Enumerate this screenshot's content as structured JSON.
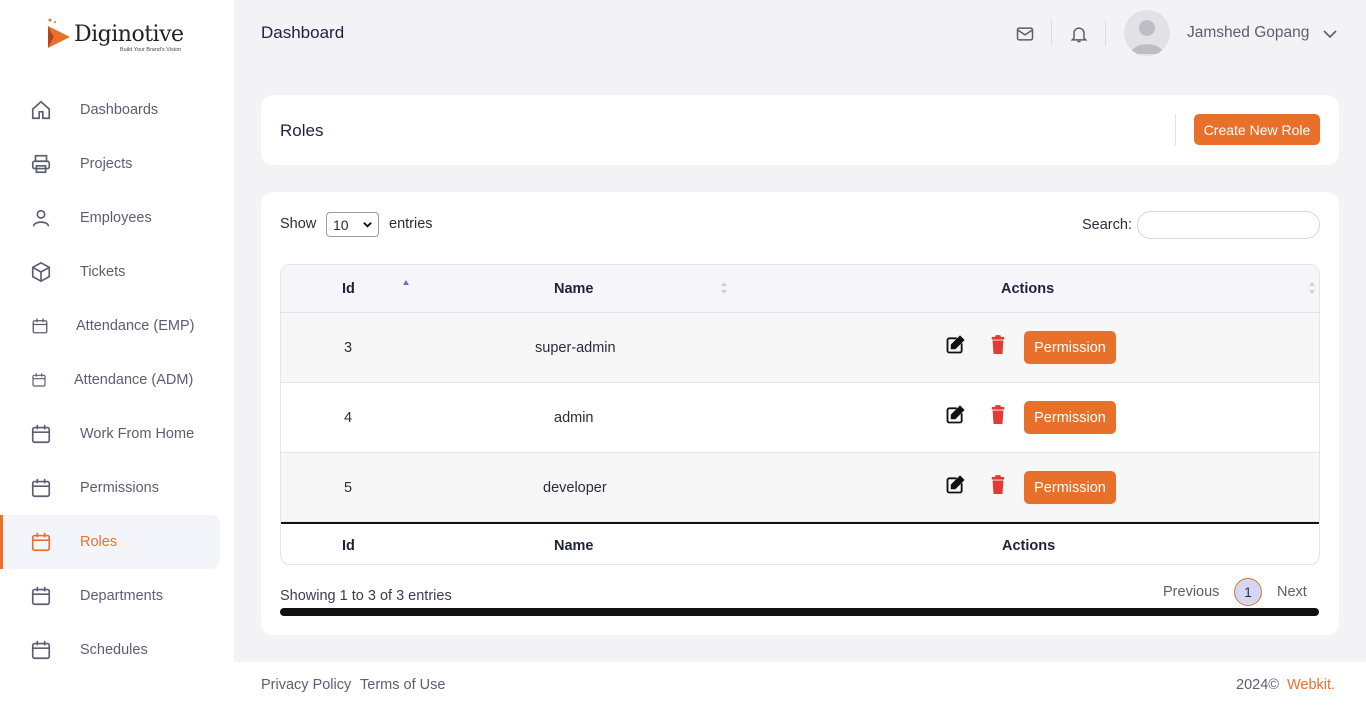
{
  "brand": {
    "name": "Diginotive",
    "tagline": "Build Your Brand's Vision",
    "accent_color": "#e8702a"
  },
  "sidebar": {
    "items": [
      {
        "label": "Dashboards",
        "icon": "home-icon"
      },
      {
        "label": "Projects",
        "icon": "printer-icon"
      },
      {
        "label": "Employees",
        "icon": "user-icon"
      },
      {
        "label": "Tickets",
        "icon": "cube-icon"
      },
      {
        "label": "Attendance (EMP)",
        "icon": "calendar-icon"
      },
      {
        "label": "Attendance (ADM)",
        "icon": "calendar-icon"
      },
      {
        "label": "Work From Home",
        "icon": "calendar-icon"
      },
      {
        "label": "Permissions",
        "icon": "calendar-icon"
      },
      {
        "label": "Roles",
        "icon": "calendar-icon",
        "active": true
      },
      {
        "label": "Departments",
        "icon": "calendar-icon"
      },
      {
        "label": "Schedules",
        "icon": "calendar-icon"
      }
    ]
  },
  "header": {
    "title": "Dashboard",
    "user_name": "Jamshed Gopang"
  },
  "roles_card": {
    "title": "Roles",
    "create_button": "Create New Role"
  },
  "table_controls": {
    "show_label": "Show",
    "entries_value": "10",
    "entries_label": "entries",
    "search_label": "Search:",
    "search_value": ""
  },
  "table": {
    "columns": [
      "Id",
      "Name",
      "Actions"
    ],
    "rows": [
      {
        "id": "3",
        "name": "super-admin",
        "action_label": "Permission"
      },
      {
        "id": "4",
        "name": "admin",
        "action_label": "Permission"
      },
      {
        "id": "5",
        "name": "developer",
        "action_label": "Permission"
      }
    ]
  },
  "pagination": {
    "info": "Showing 1 to 3 of 3 entries",
    "previous": "Previous",
    "current_page": "1",
    "next": "Next"
  },
  "footer": {
    "privacy": "Privacy Policy",
    "terms": "Terms of Use",
    "copyright": "2024©",
    "brand": "Webkit."
  }
}
